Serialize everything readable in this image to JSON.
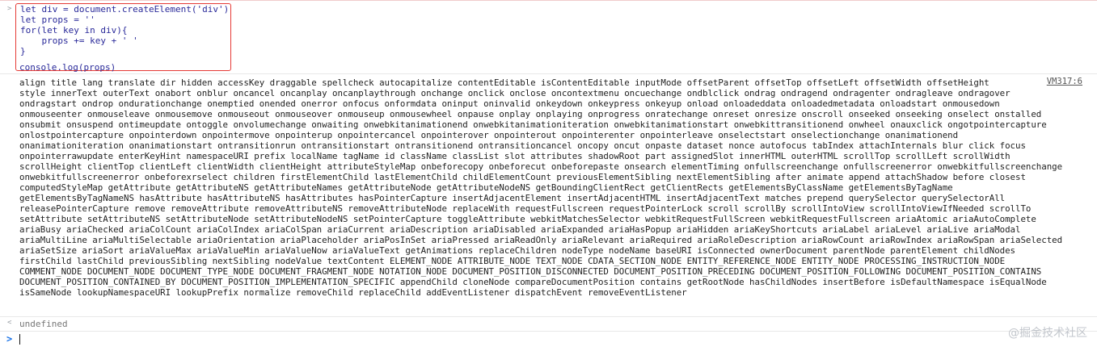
{
  "input": {
    "code_lines": [
      "let div = document.createElement('div')",
      "let props = ''",
      "for(let key in div){",
      "    props += key + ' '",
      "}"
    ],
    "after_line": "console.log(props)"
  },
  "output": {
    "source_link": "VM317:6",
    "lines": [
      "align title lang translate dir hidden accessKey draggable spellcheck autocapitalize contentEditable isContentEditable inputMode offsetParent offsetTop offsetLeft offsetWidth offsetHeight",
      "style innerText outerText onabort onblur oncancel oncanplay oncanplaythrough onchange onclick onclose oncontextmenu oncuechange ondblclick ondrag ondragend ondragenter ondragleave ondragover",
      "ondragstart ondrop ondurationchange onemptied onended onerror onfocus onformdata oninput oninvalid onkeydown onkeypress onkeyup onload onloadeddata onloadedmetadata onloadstart onmousedown",
      "onmouseenter onmouseleave onmousemove onmouseout onmouseover onmouseup onmousewheel onpause onplay onplaying onprogress onratechange onreset onresize onscroll onseeked onseeking onselect onstalled",
      "onsubmit onsuspend ontimeupdate ontoggle onvolumechange onwaiting onwebkitanimationend onwebkitanimationiteration onwebkitanimationstart onwebkittransitionend onwheel onauxclick ongotpointercapture",
      "onlostpointercapture onpointerdown onpointermove onpointerup onpointercancel onpointerover onpointerout onpointerenter onpointerleave onselectstart onselectionchange onanimationend",
      "onanimationiteration onanimationstart ontransitionrun ontransitionstart ontransitionend ontransitioncancel oncopy oncut onpaste dataset nonce autofocus tabIndex attachInternals blur click focus",
      "onpointerrawupdate enterKeyHint namespaceURI prefix localName tagName id className classList slot attributes shadowRoot part assignedSlot innerHTML outerHTML scrollTop scrollLeft scrollWidth",
      "scrollHeight clientTop clientLeft clientWidth clientHeight attributeStyleMap onbeforecopy onbeforecut onbeforepaste onsearch elementTiming onfullscreenchange onfullscreenerror onwebkitfullscreenchange",
      "onwebkitfullscreenerror onbeforexrselect children firstElementChild lastElementChild childElementCount previousElementSibling nextElementSibling after animate append attachShadow before closest",
      "computedStyleMap getAttribute getAttributeNS getAttributeNames getAttributeNode getAttributeNodeNS getBoundingClientRect getClientRects getElementsByClassName getElementsByTagName",
      "getElementsByTagNameNS hasAttribute hasAttributeNS hasAttributes hasPointerCapture insertAdjacentElement insertAdjacentHTML insertAdjacentText matches prepend querySelector querySelectorAll",
      "releasePointerCapture remove removeAttribute removeAttributeNS removeAttributeNode replaceWith requestFullscreen requestPointerLock scroll scrollBy scrollIntoView scrollIntoViewIfNeeded scrollTo",
      "setAttribute setAttributeNS setAttributeNode setAttributeNodeNS setPointerCapture toggleAttribute webkitMatchesSelector webkitRequestFullScreen webkitRequestFullscreen ariaAtomic ariaAutoComplete",
      "ariaBusy ariaChecked ariaColCount ariaColIndex ariaColSpan ariaCurrent ariaDescription ariaDisabled ariaExpanded ariaHasPopup ariaHidden ariaKeyShortcuts ariaLabel ariaLevel ariaLive ariaModal",
      "ariaMultiLine ariaMultiSelectable ariaOrientation ariaPlaceholder ariaPosInSet ariaPressed ariaReadOnly ariaRelevant ariaRequired ariaRoleDescription ariaRowCount ariaRowIndex ariaRowSpan ariaSelected",
      "ariaSetSize ariaSort ariaValueMax ariaValueMin ariaValueNow ariaValueText getAnimations replaceChildren nodeType nodeName baseURI isConnected ownerDocument parentNode parentElement childNodes",
      "firstChild lastChild previousSibling nextSibling nodeValue textContent ELEMENT_NODE ATTRIBUTE_NODE TEXT_NODE CDATA_SECTION_NODE ENTITY_REFERENCE_NODE ENTITY_NODE PROCESSING_INSTRUCTION_NODE",
      "COMMENT_NODE DOCUMENT_NODE DOCUMENT_TYPE_NODE DOCUMENT_FRAGMENT_NODE NOTATION_NODE DOCUMENT_POSITION_DISCONNECTED DOCUMENT_POSITION_PRECEDING DOCUMENT_POSITION_FOLLOWING DOCUMENT_POSITION_CONTAINS",
      "DOCUMENT_POSITION_CONTAINED_BY DOCUMENT_POSITION_IMPLEMENTATION_SPECIFIC appendChild cloneNode compareDocumentPosition contains getRootNode hasChildNodes insertBefore isDefaultNamespace isEqualNode",
      "isSameNode lookupNamespaceURI lookupPrefix normalize removeChild replaceChild addEventListener dispatchEvent removeEventListener"
    ]
  },
  "result": {
    "text": "undefined"
  },
  "watermark": "@掘金技术社区"
}
